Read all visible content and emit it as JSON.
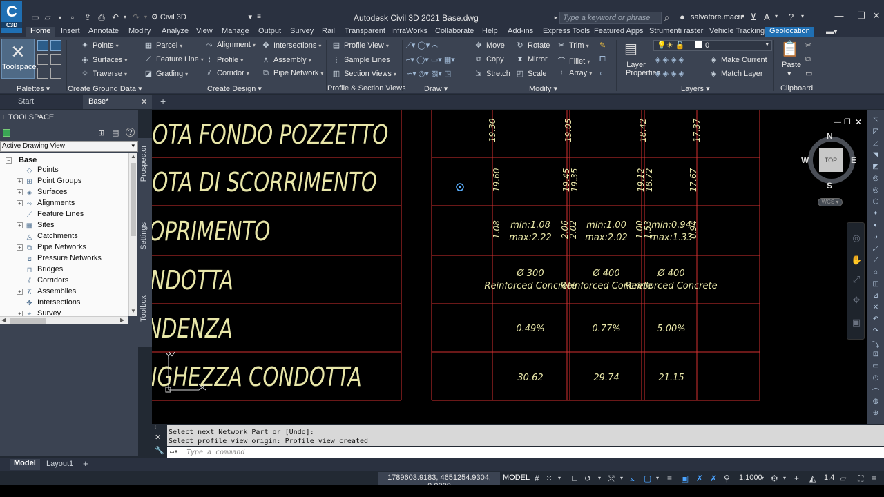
{
  "title_bar": {
    "app_logo": "C",
    "app_logo_sub": "C3D",
    "workspace": "Civil 3D",
    "window_title": "Autodesk Civil 3D 2021    Base.dwg",
    "search_placeholder": "Type a keyword or phrase",
    "user": "salvatore.macri"
  },
  "ribbon_tabs": [
    "Home",
    "Insert",
    "Annotate",
    "Modify",
    "Analyze",
    "View",
    "Manage",
    "Output",
    "Survey",
    "Rail",
    "Transparent",
    "InfraWorks",
    "Collaborate",
    "Help",
    "Add-ins",
    "Express Tools",
    "Featured Apps",
    "Strumenti raster",
    "Vehicle Tracking",
    "Geolocation"
  ],
  "ribbon": {
    "toolspace": "Toolspace",
    "points": "Points",
    "surfaces": "Surfaces",
    "traverse": "Traverse",
    "parcel": "Parcel",
    "feature_line": "Feature Line",
    "grading": "Grading",
    "alignment": "Alignment",
    "profile": "Profile",
    "corridor": "Corridor",
    "intersections": "Intersections",
    "assembly": "Assembly",
    "pipe_network": "Pipe Network",
    "profile_view": "Profile View",
    "sample_lines": "Sample Lines",
    "section_views": "Section Views",
    "move": "Move",
    "copy": "Copy",
    "stretch": "Stretch",
    "rotate": "Rotate",
    "mirror": "Mirror",
    "scale": "Scale",
    "trim": "Trim",
    "fillet": "Fillet",
    "array": "Array",
    "layer_properties_1": "Layer",
    "layer_properties_2": "Properties",
    "current_layer": "0",
    "make_current": "Make Current",
    "match_layer": "Match Layer",
    "paste": "Paste",
    "panels": {
      "palettes": "Palettes",
      "create_ground_data": "Create Ground Data",
      "create_design": "Create Design",
      "profile_section_views": "Profile & Section Views",
      "draw": "Draw",
      "modify": "Modify",
      "layers": "Layers",
      "clipboard": "Clipboard"
    }
  },
  "file_tabs": {
    "start": "Start",
    "base": "Base*"
  },
  "toolspace": {
    "title": "TOOLSPACE",
    "view": "Active Drawing View",
    "side_tabs": [
      "Prospector",
      "Settings",
      "Toolbox"
    ],
    "tree": [
      {
        "label": "Base",
        "level": 0,
        "expander": "−",
        "bold": true
      },
      {
        "label": "Points",
        "level": 1,
        "expander": ""
      },
      {
        "label": "Point Groups",
        "level": 1,
        "expander": "+"
      },
      {
        "label": "Surfaces",
        "level": 1,
        "expander": "+"
      },
      {
        "label": "Alignments",
        "level": 1,
        "expander": "+"
      },
      {
        "label": "Feature Lines",
        "level": 1,
        "expander": ""
      },
      {
        "label": "Sites",
        "level": 1,
        "expander": "+"
      },
      {
        "label": "Catchments",
        "level": 1,
        "expander": ""
      },
      {
        "label": "Pipe Networks",
        "level": 1,
        "expander": "+"
      },
      {
        "label": "Pressure Networks",
        "level": 1,
        "expander": ""
      },
      {
        "label": "Bridges",
        "level": 1,
        "expander": ""
      },
      {
        "label": "Corridors",
        "level": 1,
        "expander": ""
      },
      {
        "label": "Assemblies",
        "level": 1,
        "expander": "+"
      },
      {
        "label": "Intersections",
        "level": 1,
        "expander": ""
      },
      {
        "label": "Survey",
        "level": 1,
        "expander": "+"
      }
    ]
  },
  "drawing": {
    "row_labels": [
      "QUOTA FONDO POZZETTO",
      "QUOTA DI SCORRIMENTO",
      "RICOPRIMENTO",
      "CONDOTTA",
      "PENDENZA",
      "LUNGHEZZA CONDOTTA"
    ],
    "fondo_values": [
      "19.30",
      "19.05",
      "18.42",
      "17.37"
    ],
    "scorrimento_values": [
      "19.60",
      "19.45",
      "19.35",
      "19.12",
      "18.72",
      "17.67"
    ],
    "ricoprimento_values": [
      "1.08",
      "2.06",
      "2.02",
      "1.00",
      "1.53",
      "0.94"
    ],
    "ricoprimento_minmax": [
      {
        "min": "min:1.08",
        "max": "max:2.22"
      },
      {
        "min": "min:1.00",
        "max": "max:2.02"
      },
      {
        "min": "min:0.94",
        "max": "max:1.33"
      }
    ],
    "condotta": [
      {
        "dia": "Ø 300",
        "mat": "Reinforced Concrete"
      },
      {
        "dia": "Ø 400",
        "mat": "Reinforced Concrete"
      },
      {
        "dia": "Ø 400",
        "mat": "Reinforced Concrete"
      }
    ],
    "pendenza": [
      "0.49%",
      "0.77%",
      "5.00%"
    ],
    "lunghezza": [
      "30.62",
      "29.74",
      "21.15"
    ],
    "ucs_y": "Y"
  },
  "viewcube": {
    "n": "N",
    "s": "S",
    "e": "E",
    "w": "W",
    "top": "TOP",
    "wcs": "WCS"
  },
  "command": {
    "history_1": "Select next Network Part or [Undo]:",
    "history_2": "Select profile view origin: Profile view created",
    "placeholder": "Type a command"
  },
  "layout_tabs": [
    "Model",
    "Layout1"
  ],
  "status": {
    "coords": "1789603.9183, 4651254.9304, 0.0000",
    "model": "MODEL",
    "scale": "1:1000",
    "annotation_value": "1.4"
  }
}
